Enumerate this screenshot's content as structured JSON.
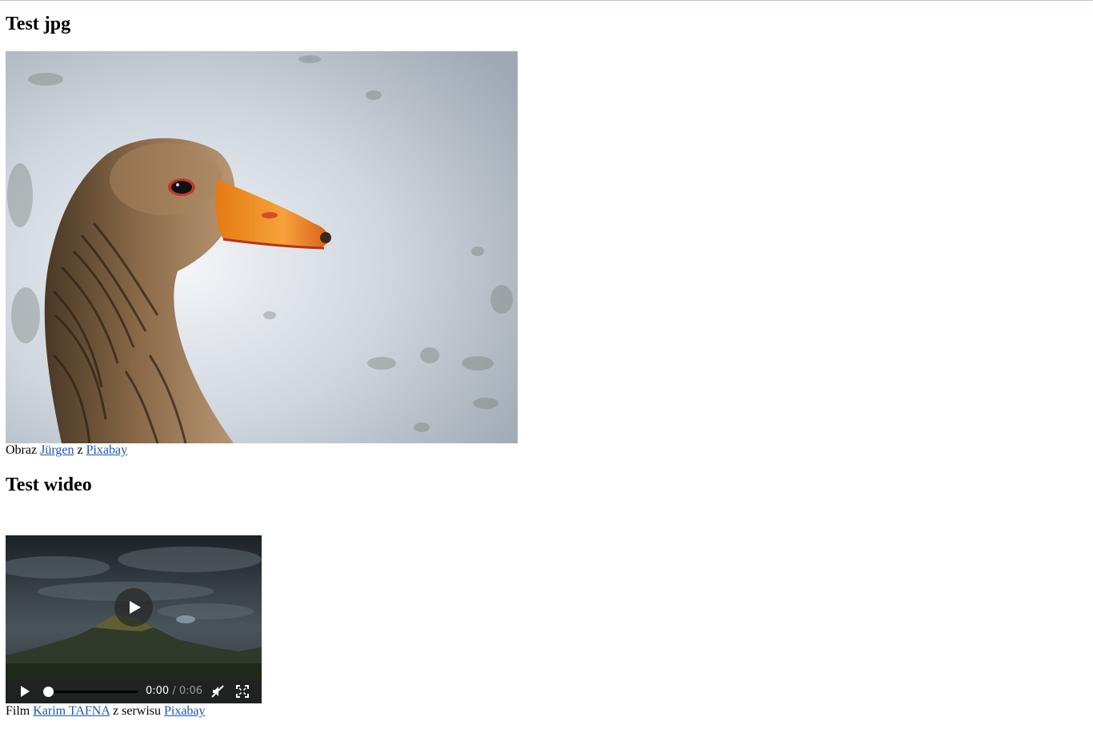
{
  "jpg_section": {
    "heading": "Test jpg",
    "image_alt": "goose",
    "caption": {
      "prefix": "Obraz ",
      "author_link": "Jürgen",
      "middle": " z ",
      "source_link": "Pixabay"
    }
  },
  "video_section": {
    "heading": "Test wideo",
    "player": {
      "current_time": "0:00",
      "separator": " / ",
      "duration": "0:06",
      "progress": 0
    },
    "caption": {
      "prefix": "Film ",
      "author_link": "Karim TAFNA",
      "middle": " z serwisu ",
      "source_link": "Pixabay"
    }
  },
  "colors": {
    "link": "#1a56b8",
    "goose_beak": "#f28a1c",
    "sky": "#c9d2db",
    "video_dark": "#23282c"
  }
}
